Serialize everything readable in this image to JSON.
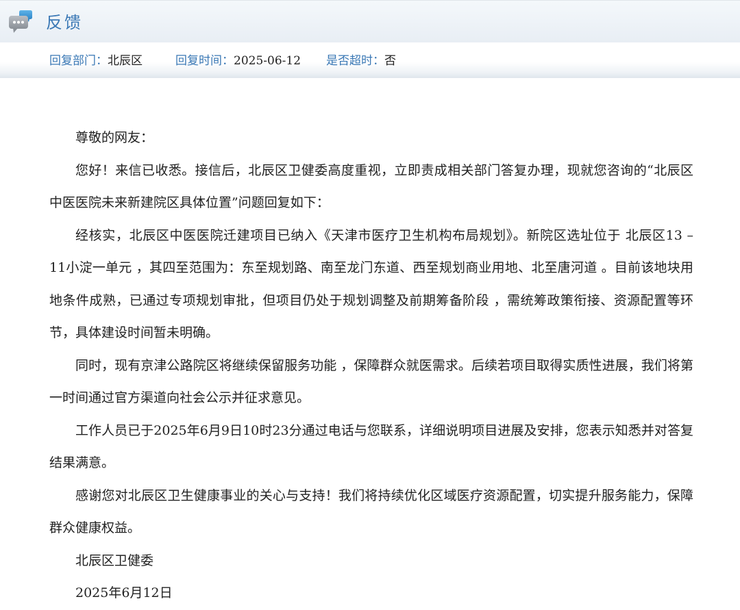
{
  "header": {
    "title": "反馈",
    "icon": "chat-bubbles-icon"
  },
  "meta": {
    "dept_label": "回复部门：",
    "dept_value": "北辰区",
    "time_label": "回复时间：",
    "time_value": "2025-06-12",
    "overdue_label": "是否超时：",
    "overdue_value": "否"
  },
  "letter": {
    "greeting": "尊敬的网友：",
    "p1": "您好！来信已收悉。接信后，北辰区卫健委高度重视，立即责成相关部门答复办理，现就您咨询的“北辰区中医医院未来新建院区具体位置”问题回复如下：",
    "p2": "经核实，北辰区中医医院迁建项目已纳入《天津市医疗卫生机构布局规划》。新院区选址位于 北辰区13 – 11小淀一单元 ，其四至范围为：东至规划路、南至龙门东道、西至规划商业用地、北至唐河道 。目前该地块用地条件成熟，已通过专项规划审批，但项目仍处于规划调整及前期筹备阶段 ，需统筹政策衔接、资源配置等环节，具体建设时间暂未明确。",
    "p3": "同时，现有京津公路院区将继续保留服务功能 ，保障群众就医需求。后续若项目取得实质性进展，我们将第一时间通过官方渠道向社会公示并征求意见。",
    "p4": "工作人员已于2025年6月9日10时23分通过电话与您联系，详细说明项目进展及安排，您表示知悉并对答复结果满意。",
    "p5": "感谢您对北辰区卫生健康事业的关心与支持！我们将持续优化区域医疗资源配置，切实提升服务能力，保障群众健康权益。",
    "signature": "北辰区卫健委",
    "date": "2025年6月12日"
  },
  "colors": {
    "accent": "#3a78b5",
    "text": "#222222",
    "header_bg": "#edf2f7"
  }
}
